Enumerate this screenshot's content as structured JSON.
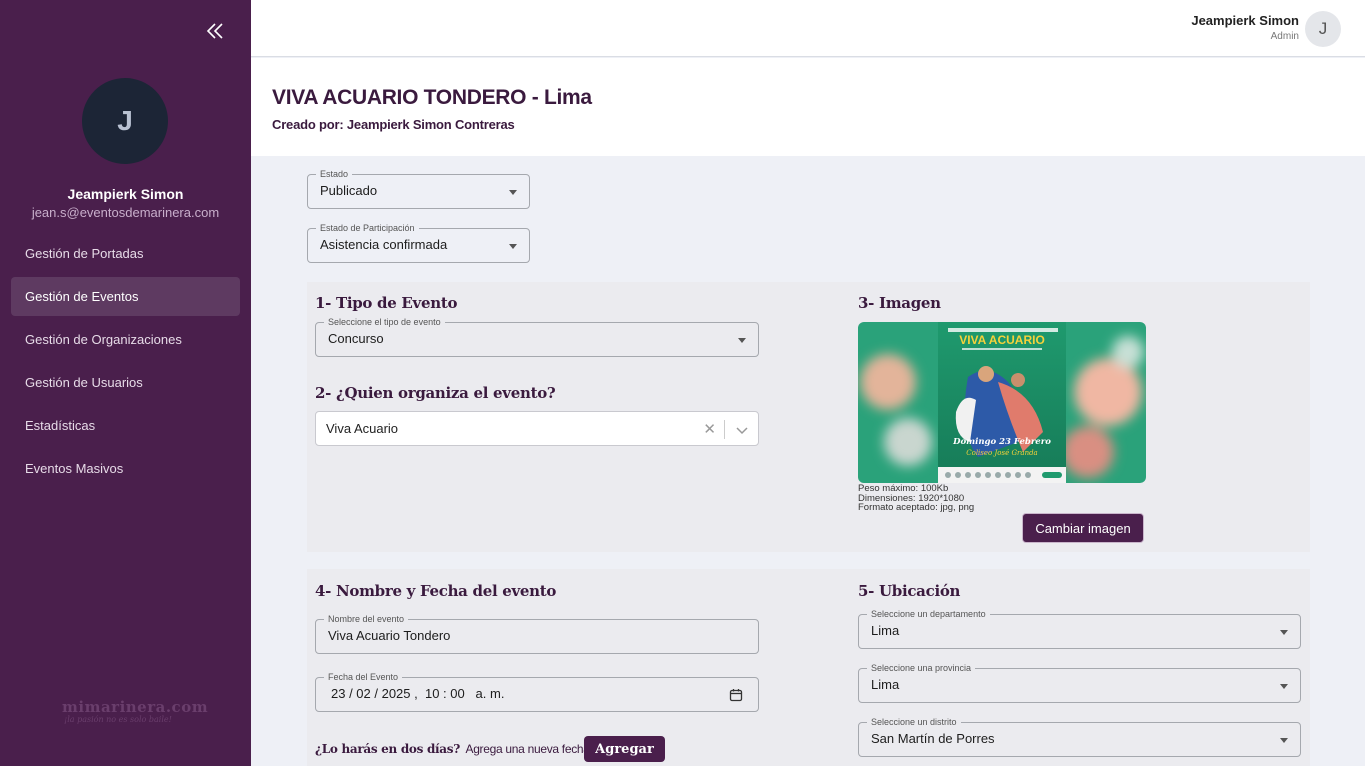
{
  "sidebar": {
    "user_initial": "J",
    "user_name": "Jeampierk Simon",
    "user_email": "jean.s@eventosdemarinera.com",
    "nav": [
      {
        "label": "Gestión de Portadas",
        "active": false
      },
      {
        "label": "Gestión de Eventos",
        "active": true
      },
      {
        "label": "Gestión de Organizaciones",
        "active": false
      },
      {
        "label": "Gestión de Usuarios",
        "active": false
      },
      {
        "label": "Estadísticas",
        "active": false
      },
      {
        "label": "Eventos Masivos",
        "active": false
      }
    ],
    "watermark_line1": "mimarinera.com",
    "watermark_line2": "¡la pasión no es solo baile!"
  },
  "topbar": {
    "user_name": "Jeampierk Simon",
    "user_role": "Admin",
    "user_initial": "J"
  },
  "header": {
    "title": "VIVA ACUARIO TONDERO - Lima",
    "subtitle": "Creado por: Jeampierk Simon Contreras"
  },
  "status": {
    "estado_label": "Estado",
    "estado_value": "Publicado",
    "participacion_label": "Estado de Participación",
    "participacion_value": "Asistencia confirmada"
  },
  "section1": {
    "title": "1- Tipo de Evento",
    "field_label": "Seleccione el tipo de evento",
    "field_value": "Concurso"
  },
  "section2": {
    "title": "2- ¿Quien organiza el evento?",
    "value": "Viva Acuario"
  },
  "section3": {
    "title": "3- Imagen",
    "poster_title": "VIVA ACUARIO",
    "poster_date": "Domingo 23 Febrero",
    "poster_place": "Coliseo José Granda",
    "meta": [
      "Peso máximo: 100Kb",
      "Dimensiones: 1920*1080",
      "Formato aceptado: jpg, png"
    ],
    "change_button": "Cambiar imagen"
  },
  "section4": {
    "title": "4- Nombre y Fecha del evento",
    "name_label": "Nombre del evento",
    "name_value": "Viva Acuario Tondero",
    "date_label": "Fecha del Evento",
    "date_value": "23 / 02 / 2025 ,  10 : 00   a. m.",
    "two_days_question": "¿Lo harás en dos días?",
    "two_days_link": "Agrega una nueva fecha",
    "add_button": "Agregar"
  },
  "section5": {
    "title": "5- Ubicación",
    "dept_label": "Seleccione un departamento",
    "dept_value": "Lima",
    "prov_label": "Seleccione una provincia",
    "prov_value": "Lima",
    "dist_label": "Seleccione un distrito",
    "dist_value": "San Martín de Porres"
  },
  "colors": {
    "sidebar_bg": "#4a1f4c",
    "accent": "#4a1f4c",
    "page_bg": "#eef0f6"
  }
}
